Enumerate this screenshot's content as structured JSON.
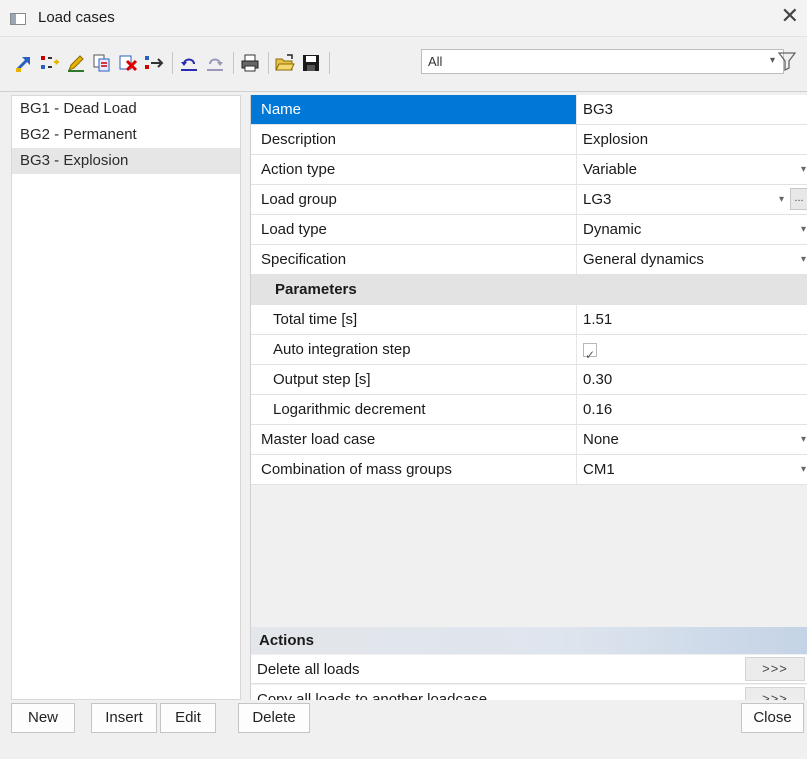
{
  "window": {
    "title": "Load cases"
  },
  "toolbar": {
    "filter_value": "All"
  },
  "load_cases": [
    "BG1 - Dead Load",
    "BG2 - Permanent",
    "BG3 - Explosion"
  ],
  "selected_index": 2,
  "properties": [
    {
      "name": "Name",
      "value": "BG3",
      "dropdown": false,
      "selected": true
    },
    {
      "name": "Description",
      "value": "Explosion",
      "dropdown": false
    },
    {
      "name": "Action type",
      "value": "Variable",
      "dropdown": true
    },
    {
      "name": "Load group",
      "value": "LG3",
      "dropdown": true,
      "ellipsis": "..."
    },
    {
      "name": "Load type",
      "value": "Dynamic",
      "dropdown": true
    },
    {
      "name": "Specification",
      "value": "General dynamics",
      "dropdown": true
    }
  ],
  "parameters": {
    "title": "Parameters",
    "rows": [
      {
        "name": "Total time [s]",
        "value": "1.51"
      },
      {
        "name": "Auto integration step",
        "value": "",
        "checkbox": true,
        "checked": true
      },
      {
        "name": "Output step [s]",
        "value": "0.30"
      },
      {
        "name": "Logarithmic decrement",
        "value": "0.16"
      }
    ]
  },
  "more_properties": [
    {
      "name": "Master load case",
      "value": "None",
      "dropdown": true
    },
    {
      "name": "Combination of mass groups",
      "value": "CM1",
      "dropdown": true
    }
  ],
  "actions": {
    "title": "Actions",
    "items": [
      {
        "label": "Delete all loads",
        "button": ">>>"
      },
      {
        "label": "Copy all loads to another loadcase",
        "button": ">>>"
      }
    ]
  },
  "buttons": {
    "new": "New",
    "insert": "Insert",
    "edit": "Edit",
    "delete": "Delete",
    "close": "Close"
  },
  "colors": {
    "selection": "#0078d7",
    "accent": "#c4d3e6"
  }
}
